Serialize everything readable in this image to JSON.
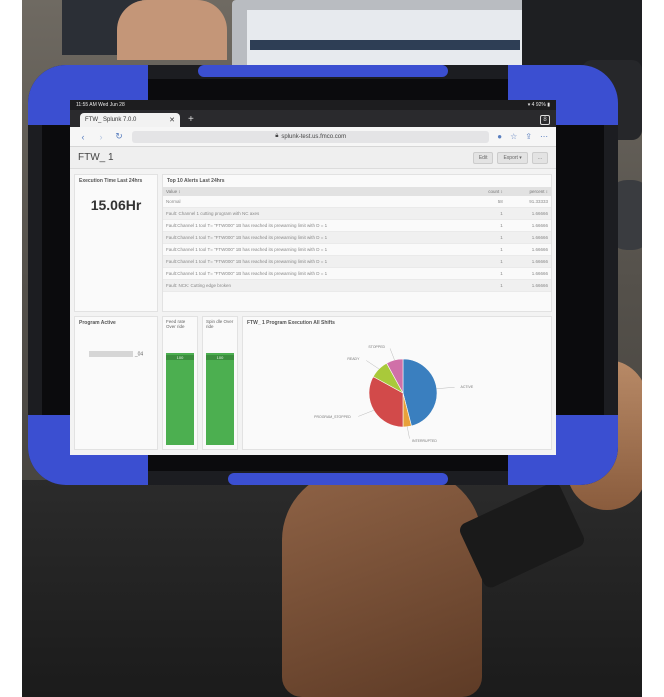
{
  "ipad": {
    "status_left": "11:55 AM  Wed Jun 28",
    "status_right": "▾ 4 92% ▮"
  },
  "browser": {
    "tab_title": "FTW_     Splunk 7.0.0",
    "tab_count": "8",
    "url": "splunk-test.us.fmco.com"
  },
  "dashboard": {
    "title": "FTW_     1",
    "edit_label": "Edit",
    "export_label": "Export ▾",
    "more_label": "...",
    "exec_time": {
      "title": "Execution Time Last 24hrs",
      "value": "15.06Hr"
    },
    "alerts": {
      "title": "Top 10 Alerts Last 24hrs",
      "columns": [
        "Value ↕",
        "count ↕",
        "percent ↕"
      ],
      "rows": [
        {
          "value": "Normal",
          "count": "58",
          "percent": "91.33333"
        },
        {
          "value": "Fault: Channel 1 cutting program with NC axes",
          "count": "1",
          "percent": "1.66666"
        },
        {
          "value": "Fault:Channel 1 tool T= \"FTW000\" 1B has reached its prewarning limit with D = 1",
          "count": "1",
          "percent": "1.66666"
        },
        {
          "value": "Fault:Channel 1 tool T= \"FTW000\" 1B has reached its prewarning limit with D = 1",
          "count": "1",
          "percent": "1.66666"
        },
        {
          "value": "Fault:Channel 1 tool T= \"FTW000\" 1B has reached its prewarning limit with D = 1",
          "count": "1",
          "percent": "1.66666"
        },
        {
          "value": "Fault:Channel 1 tool T= \"FTW000\" 1B has reached its prewarning limit with D = 1",
          "count": "1",
          "percent": "1.66666"
        },
        {
          "value": "Fault:Channel 1 tool T= \"FTW000\" 1B has reached its prewarning limit with D = 1",
          "count": "1",
          "percent": "1.66666"
        },
        {
          "value": "Fault: NCK: Cutting edge broken",
          "count": "1",
          "percent": "1.66666"
        }
      ]
    },
    "program_active": {
      "title": "Program Active",
      "value_suffix": "_04"
    },
    "gauges": [
      {
        "label": "Feed rate Over ride",
        "display": "100",
        "value": 100
      },
      {
        "label": "Spin dle Over ride",
        "display": "100",
        "value": 100
      }
    ],
    "pie": {
      "title": "FTW_     1 Program Execution All Shifts",
      "slices": [
        {
          "label": "ACTIVE",
          "value": 46,
          "color": "#3a7fbf"
        },
        {
          "label": "INTERRUPTED",
          "value": 4,
          "color": "#e8a13a"
        },
        {
          "label": "PROGRAM_STOPPED",
          "value": 33,
          "color": "#d24a4a"
        },
        {
          "label": "READY",
          "value": 9,
          "color": "#a9c93a"
        },
        {
          "label": "STOPPED",
          "value": 8,
          "color": "#d070a8"
        }
      ]
    }
  }
}
